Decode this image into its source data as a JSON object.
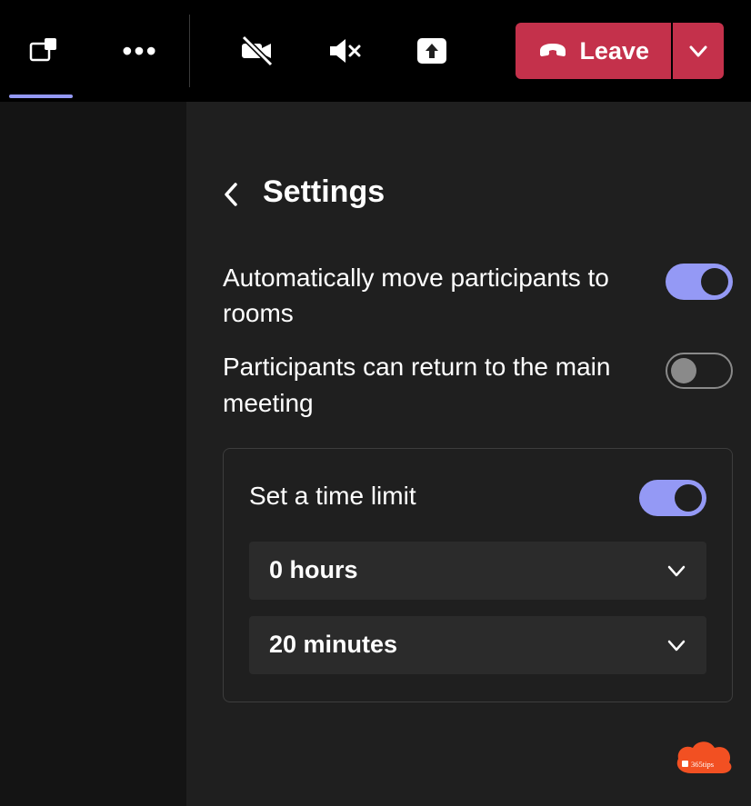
{
  "topbar": {
    "leave_label": "Leave"
  },
  "settings": {
    "title": "Settings",
    "auto_move": {
      "label": "Automatically move participants to rooms",
      "on": true
    },
    "return_main": {
      "label": "Participants can return to the main meeting",
      "on": false
    },
    "time_limit": {
      "label": "Set a time limit",
      "on": true,
      "hours_value": "0 hours",
      "minutes_value": "20 minutes"
    }
  },
  "badge": {
    "text": "365tips"
  }
}
